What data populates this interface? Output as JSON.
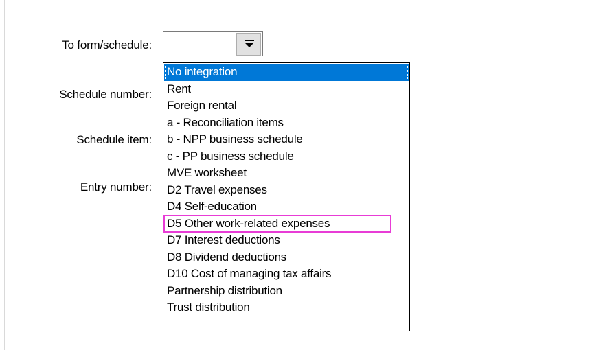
{
  "form": {
    "fields": [
      {
        "label": "To form/schedule:"
      },
      {
        "label": "Schedule number:"
      },
      {
        "label": "Schedule item:"
      },
      {
        "label": "Entry number:"
      }
    ]
  },
  "combo": {
    "value": "",
    "button_icon": "dropdown-arrow-icon",
    "selected_option": "No integration",
    "highlighted_option": "D5 Other work-related expenses",
    "highlight_color": "#e83cd6",
    "selection_color": "#0078d7"
  },
  "dropdown": {
    "options": [
      "No integration",
      "Rent",
      "Foreign rental",
      "a - Reconciliation items",
      "b - NPP business schedule",
      "c - PP business schedule",
      "MVE worksheet",
      "D2 Travel expenses",
      "D4 Self-education",
      "D5 Other work-related expenses",
      "D7 Interest deductions",
      "D8 Dividend deductions",
      "D10 Cost of managing tax affairs",
      "Partnership distribution",
      "Trust distribution"
    ]
  }
}
